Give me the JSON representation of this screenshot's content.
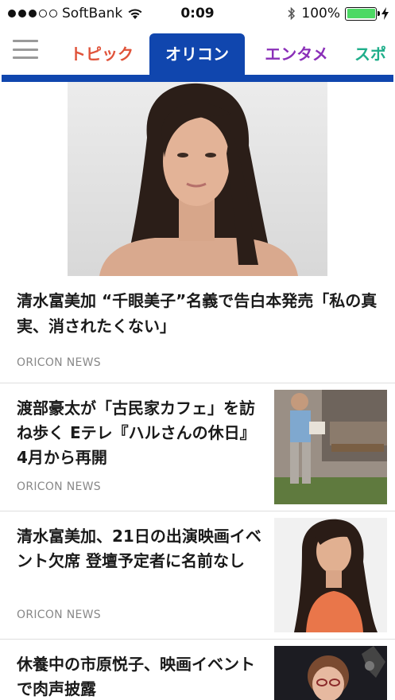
{
  "status_bar": {
    "carrier": "SoftBank",
    "time": "0:09",
    "battery": "100%"
  },
  "tabs": [
    {
      "label": "トピック",
      "color": "#e0533a"
    },
    {
      "label": "オリコン",
      "color": "#ffffff",
      "active": true
    },
    {
      "label": "エンタメ",
      "color": "#8a2fb8"
    },
    {
      "label": "スポ",
      "color": "#1fae8a"
    }
  ],
  "accent_color": "#1046ae",
  "hero": {
    "title": "清水富美加 “千眼美子”名義で告白本発売「私の真実、消されたくない」",
    "source": "ORICON NEWS"
  },
  "articles": [
    {
      "title": "渡部豪太が「古民家カフェ」を訪ね歩く Eテレ『ハルさんの休日』4月から再開",
      "source": "ORICON NEWS"
    },
    {
      "title": "清水富美加、21日の出演映画イベント欠席 登壇予定者に名前なし",
      "source": "ORICON NEWS"
    },
    {
      "title": "休養中の市原悦子、映画イベントで肉声披露",
      "source": ""
    }
  ]
}
